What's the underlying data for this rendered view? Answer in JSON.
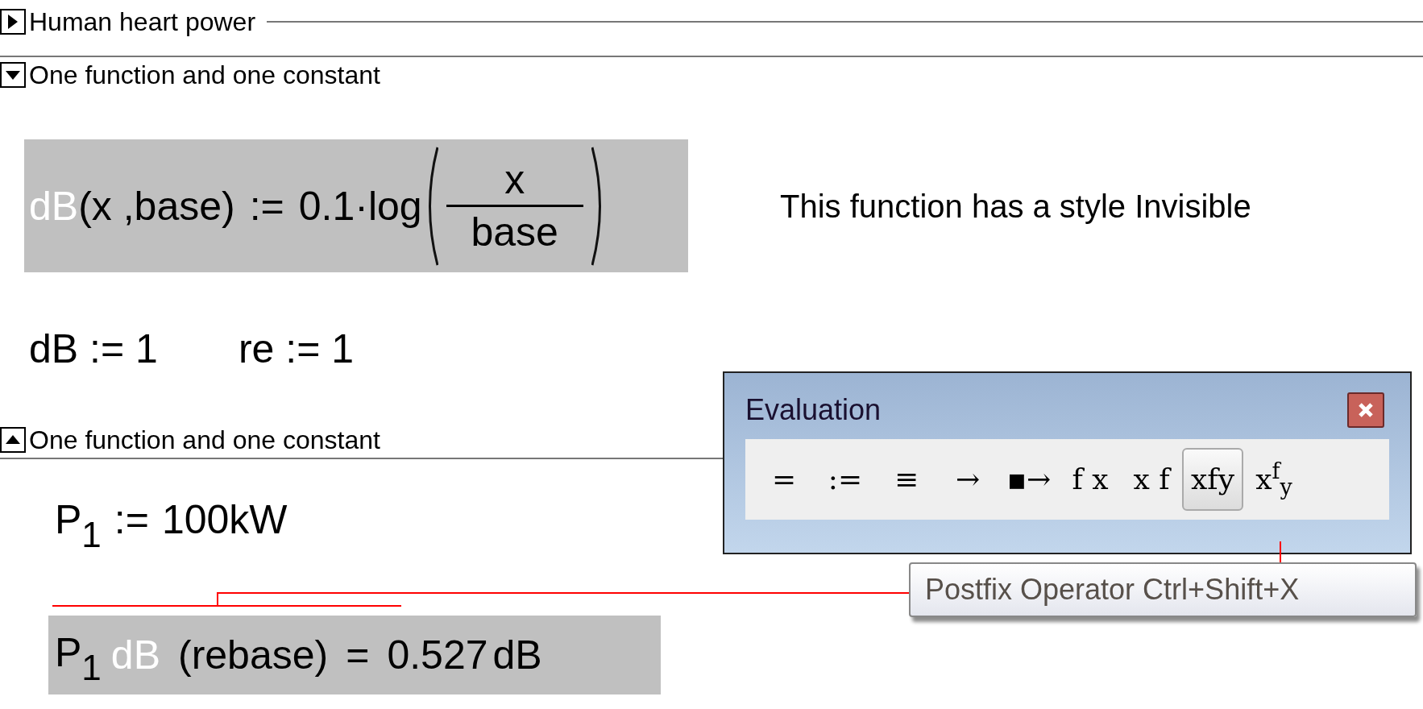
{
  "regions": [
    {
      "kind": "collapsed",
      "title": "Human heart power"
    },
    {
      "kind": "expanded",
      "title": "One function and one constant"
    }
  ],
  "function_definition": {
    "highlighted": true,
    "name": "dB",
    "invisible": true,
    "arguments": "(x ,base)",
    "operator": ":=",
    "expression": "0.1·log",
    "numerator": "x",
    "denominator": "base"
  },
  "note": "This function has a style Invisible",
  "definitions": [
    {
      "name": "dB",
      "operator": ":=",
      "value": "1"
    },
    {
      "name": "re",
      "operator": ":=",
      "value": "1"
    }
  ],
  "region_end": {
    "kind": "end",
    "title": "One function and one constant"
  },
  "power_definition": {
    "name": "P",
    "subscript": "1",
    "operator": ":=",
    "value": "100kW"
  },
  "result": {
    "highlighted": true,
    "name": "P",
    "subscript": "1",
    "postfix": "dB",
    "invisible": true,
    "argument": "(rebase)",
    "operator": "=",
    "value": "0.527",
    "unit": "dB"
  },
  "toolbar": {
    "title": "Evaluation",
    "buttons": [
      {
        "label": "=",
        "selected": false
      },
      {
        "label": ":=",
        "selected": false
      },
      {
        "label": "≡",
        "selected": false
      },
      {
        "label": "→",
        "selected": false
      },
      {
        "label": "▪→",
        "selected": false
      },
      {
        "label": "f x",
        "selected": false
      },
      {
        "label": "x f",
        "selected": false
      },
      {
        "label": "xfy",
        "selected": true
      },
      {
        "label": "x$^{f}$$_{y}$",
        "selected": false
      }
    ]
  },
  "tooltip": "Postfix Operator Ctrl+Shift+X"
}
